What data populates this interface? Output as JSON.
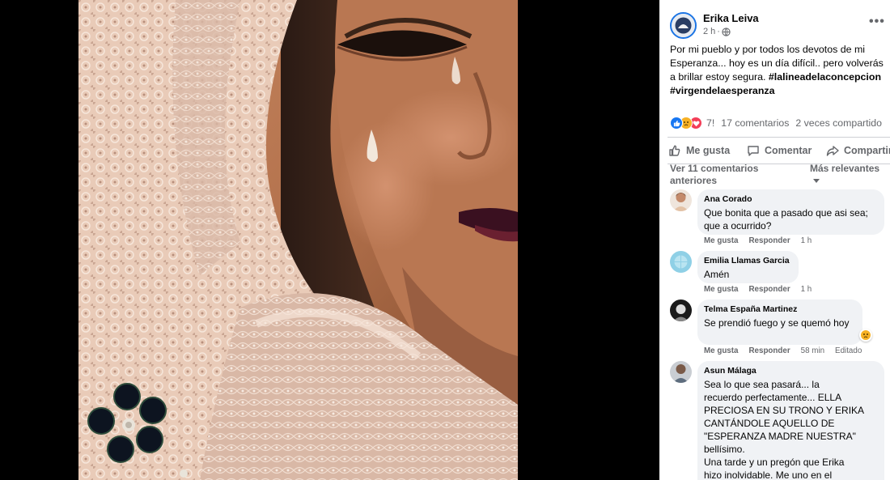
{
  "post": {
    "author": "Erika Leiva",
    "time": "2 h",
    "more_icon": "•••",
    "text_parts": [
      "Por mi pueblo y por todos los devotos de mi Esperanza... hoy es un día difícil.. pero volverás a brillar estoy segura. "
    ],
    "hashtags": [
      "#lalineadelaconcepcion",
      "#virgendelaesperanza"
    ],
    "reaction_count": "7!",
    "comments_count": "17 comentarios",
    "shares_count": "2 veces compartido",
    "reaction_icons": [
      "like-icon",
      "sad-icon",
      "love-icon"
    ]
  },
  "actions": {
    "like": "Me gusta",
    "comment": "Comentar",
    "share": "Compartir"
  },
  "comments_header": {
    "previous": "Ver 11 comentarios anteriores",
    "sort": "Más relevantes"
  },
  "comments": [
    {
      "name": "Ana Corado",
      "text": "Que bonita que a pasado que asi sea; que a ocurrido?",
      "like": "Me gusta",
      "reply": "Responder",
      "time": "1 h",
      "edited": ""
    },
    {
      "name": "Emilia Llamas Garcia",
      "text": "Amén",
      "like": "Me gusta",
      "reply": "Responder",
      "time": "1 h",
      "edited": ""
    },
    {
      "name": "Telma España Martinez",
      "text": "Se prendió fuego y se quemó hoy",
      "like": "Me gusta",
      "reply": "Responder",
      "time": "58 min",
      "edited": "Editado",
      "reaction": "sad-icon"
    },
    {
      "name": "Asun Málaga",
      "text_lines": [
        "Sea lo que sea pasará... la",
        "recuerdo perfectamente... ELLA",
        "PRECIOSA EN SU TRONO Y ERIKA",
        "CANTÁNDOLE AQUELLO DE",
        "\"ESPERANZA MADRE NUESTRA\"",
        "bellísimo.",
        "Una tarde y un pregón que Erika",
        "hizo inolvidable. Me uno en el"
      ]
    }
  ],
  "colors": {
    "accent": "#1877f2",
    "bubble": "#f0f2f5",
    "secondary_text": "#65676b"
  }
}
